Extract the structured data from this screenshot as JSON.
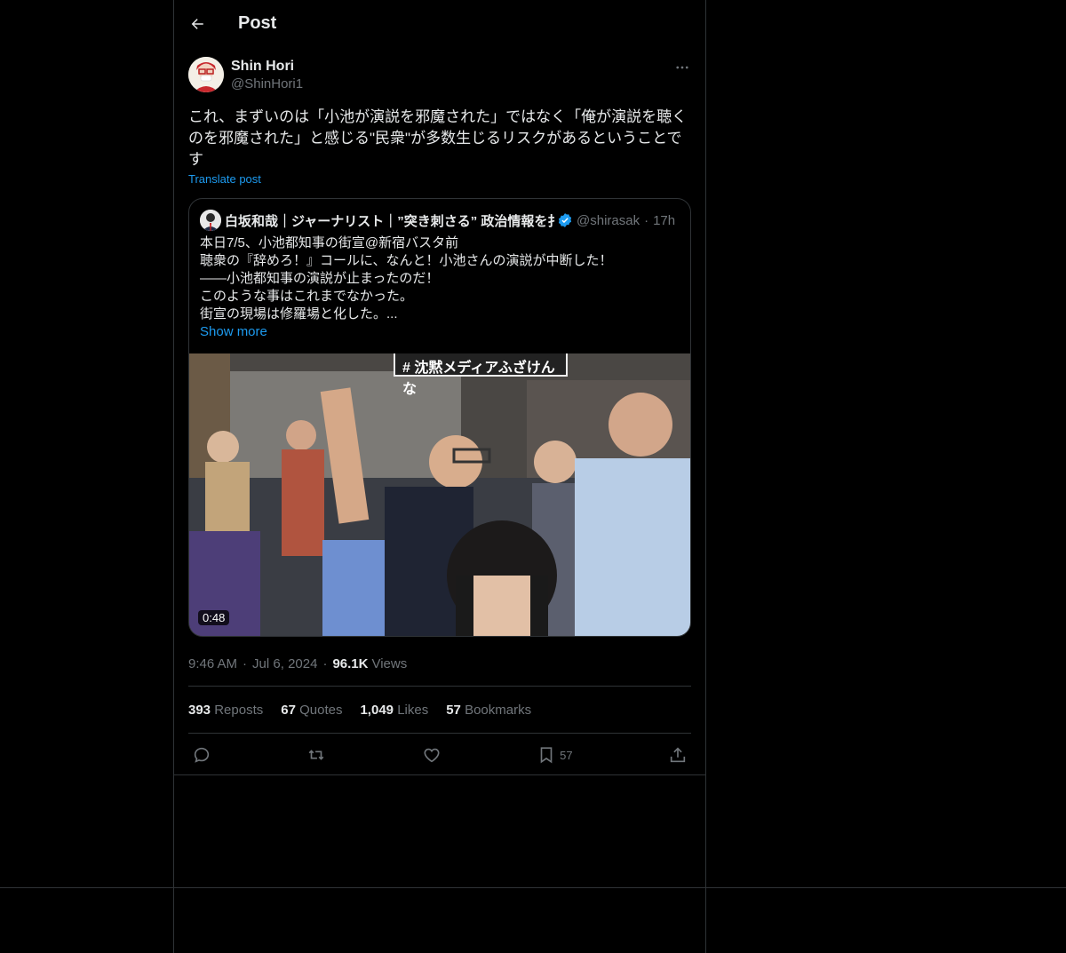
{
  "header": {
    "title": "Post"
  },
  "post": {
    "author_name": "Shin Hori",
    "author_handle": "@ShinHori1",
    "text": "これ、まずいのは「小池が演説を邪魔された」ではなく「俺が演説を聴く\nのを邪魔された」と感じる\"民衆\"が多数生じるリスクがあるということで\nす",
    "translate_label": "Translate post",
    "quote": {
      "author_name": "白坂和哉｜ジャーナリスト｜”突き刺さる” 政治情報を扌",
      "author_handle": "@shirasak",
      "time": "17h",
      "lines": [
        "本日7/5、小池都知事の街宣@新宿バスタ前",
        "聴衆の『辞めろ！』コールに、なんと！小池さんの演説が中断した！",
        "――小池都知事の演説が止まったのだ！",
        "このような事はこれまでなかった。",
        "街宣の現場は修羅場と化した。..."
      ],
      "show_more": "Show more",
      "video_duration": "0:48",
      "video_sign_text": "# 沈黙メディアふざけんな"
    },
    "time": "9:46 AM",
    "date": "Jul 6, 2024",
    "views_count": "96.1K",
    "views_label": "Views",
    "stats": {
      "reposts_count": "393",
      "reposts_label": "Reposts",
      "quotes_count": "67",
      "quotes_label": "Quotes",
      "likes_count": "1,049",
      "likes_label": "Likes",
      "bookmarks_count": "57",
      "bookmarks_label": "Bookmarks"
    },
    "actions": {
      "bookmark_count": "57"
    }
  },
  "icons": [
    "back-arrow-icon",
    "more-icon",
    "verified-icon",
    "reply-icon",
    "repost-icon",
    "like-icon",
    "bookmark-icon",
    "share-icon"
  ],
  "colors": {
    "background": "#000000",
    "text": "#e7e9ea",
    "muted": "#71767b",
    "accent": "#1d9bf0",
    "border": "#2f3336"
  }
}
